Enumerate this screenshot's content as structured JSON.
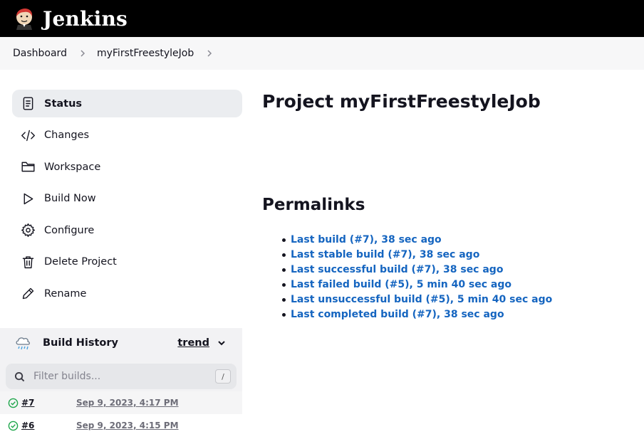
{
  "app": {
    "brand": "Jenkins"
  },
  "breadcrumb": [
    "Dashboard",
    "myFirstFreestyleJob"
  ],
  "sidebar": {
    "items": [
      {
        "label": "Status",
        "icon": "status-icon",
        "active": true
      },
      {
        "label": "Changes",
        "icon": "code-icon"
      },
      {
        "label": "Workspace",
        "icon": "folder-icon"
      },
      {
        "label": "Build Now",
        "icon": "play-icon"
      },
      {
        "label": "Configure",
        "icon": "gear-icon"
      },
      {
        "label": "Delete Project",
        "icon": "trash-icon"
      },
      {
        "label": "Rename",
        "icon": "pencil-icon"
      }
    ]
  },
  "build_history": {
    "title": "Build History",
    "trend": "trend",
    "filter_placeholder": "Filter builds...",
    "shortcut": "/",
    "builds": [
      {
        "number": "#7",
        "date": "Sep 9, 2023, 4:17 PM",
        "status": "success"
      },
      {
        "number": "#6",
        "date": "Sep 9, 2023, 4:15 PM",
        "status": "success"
      }
    ]
  },
  "main": {
    "title": "Project myFirstFreestyleJob",
    "permalinks_heading": "Permalinks",
    "permalinks": [
      "Last build (#7), 38 sec ago",
      "Last stable build (#7), 38 sec ago",
      "Last successful build (#7), 38 sec ago",
      "Last failed build (#5), 5 min 40 sec ago",
      "Last unsuccessful build (#5), 5 min 40 sec ago",
      "Last completed build (#7), 38 sec ago"
    ]
  },
  "colors": {
    "header_bg": "#000000",
    "link": "#1565c0",
    "success": "#1ea64b"
  }
}
